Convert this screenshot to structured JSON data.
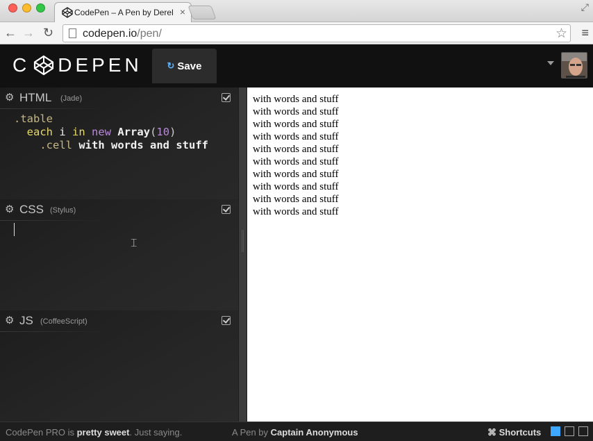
{
  "browser": {
    "tab_title": "CodePen – A Pen by Derek",
    "url_host": "codepen.io",
    "url_path": "/pen/"
  },
  "header": {
    "logo_left": "C",
    "logo_right": "DEPEN",
    "save_label": "Save"
  },
  "editors": {
    "html": {
      "title": "HTML",
      "preprocessor": "(Jade)"
    },
    "css": {
      "title": "CSS",
      "preprocessor": "(Stylus)"
    },
    "js": {
      "title": "JS",
      "preprocessor": "(CoffeeScript)"
    }
  },
  "code": {
    "line1": ".table",
    "line2_kw1": "each",
    "line2_var": "i",
    "line2_kw2": "in",
    "line2_new": "new",
    "line2_type": "Array",
    "line2_open": "(",
    "line2_num": "10",
    "line2_close": ")",
    "line3_class": ".cell",
    "line3_text": "with words and stuff"
  },
  "preview": {
    "lines": [
      "with words and stuff",
      "with words and stuff",
      "with words and stuff",
      "with words and stuff",
      "with words and stuff",
      "with words and stuff",
      "with words and stuff",
      "with words and stuff",
      "with words and stuff",
      "with words and stuff"
    ]
  },
  "footer": {
    "promo_pre": "CodePen PRO is ",
    "promo_bold": "pretty sweet",
    "promo_post": ". Just saying.",
    "pen_by_pre": "A Pen by ",
    "pen_by_author": "Captain Anonymous",
    "shortcuts": "⌘ Shortcuts"
  }
}
